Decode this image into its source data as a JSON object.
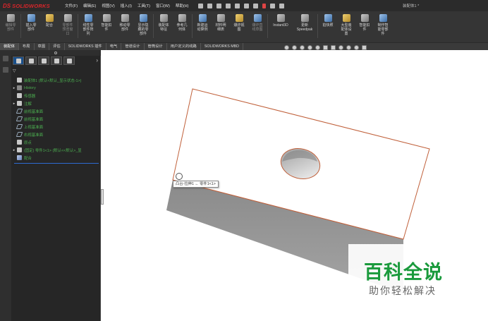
{
  "app": {
    "logo_ds": "DS",
    "logo_text": "SOLIDWORKS",
    "document_title": "装配体1 *"
  },
  "menu": [
    "文件(F)",
    "编辑(E)",
    "视图(V)",
    "插入(I)",
    "工具(T)",
    "窗口(W)",
    "帮助(H)"
  ],
  "ribbon": [
    {
      "label": "编辑零\n部件",
      "dim": true
    },
    {
      "label": "插入零\n部件"
    },
    {
      "label": "配合"
    },
    {
      "label": "零部件\n预览窗\n口",
      "dim": true
    },
    {
      "label": "线性零\n部件阵\n列"
    },
    {
      "label": "智能扣\n件"
    },
    {
      "label": "移动零\n部件"
    },
    {
      "label": "显示隐\n藏的零\n部件"
    },
    {
      "label": "装配体\n特征"
    },
    {
      "label": "参考几\n何体"
    },
    {
      "label": "新建运\n动算例"
    },
    {
      "label": "材料明\n细表"
    },
    {
      "label": "爆炸视\n图"
    },
    {
      "label": "爆炸直\n线草图",
      "dim": true
    },
    {
      "label": "Instant3D"
    },
    {
      "label": "更新\nSpeedpak"
    },
    {
      "label": "拍快照"
    },
    {
      "label": "大型装\n配体设\n置"
    },
    {
      "label": "智能扣\n件"
    },
    {
      "label": "制作智\n能零部\n件"
    }
  ],
  "tabs": [
    "装配体",
    "布局",
    "草图",
    "评估",
    "SOLIDWORKS 插件",
    "电气",
    "管道设计",
    "管筒设计",
    "用户定义的线路",
    "SOLIDWORKS MBD"
  ],
  "active_tab": "装配体",
  "tree": {
    "filter_symbol": "▽",
    "root": "装配体1 (默认<默认_显示状态-1>)",
    "items": [
      {
        "label": "History",
        "icon": "history-icon",
        "expand": "▸"
      },
      {
        "label": "传感器",
        "icon": "sensor-icon",
        "expand": ""
      },
      {
        "label": "注解",
        "icon": "annotation-icon",
        "expand": "▸"
      },
      {
        "label": "前视基准面",
        "icon": "plane-icon",
        "expand": ""
      },
      {
        "label": "前视基准面",
        "icon": "plane-icon",
        "expand": ""
      },
      {
        "label": "上视基准面",
        "icon": "plane-icon",
        "expand": ""
      },
      {
        "label": "右视基准面",
        "icon": "plane-icon",
        "expand": ""
      },
      {
        "label": "原点",
        "icon": "origin-icon",
        "expand": ""
      },
      {
        "label": "(固定) 零件1<1> (默认<<默认>_显",
        "icon": "part-icon",
        "expand": "▸"
      },
      {
        "label": "配合",
        "icon": "mate-icon",
        "expand": ""
      }
    ]
  },
  "viewport": {
    "tooltip": "凸台-拉伸1 ← 零件1<1>"
  },
  "watermark": {
    "title": "百科全说",
    "subtitle": "助你轻松解决"
  }
}
